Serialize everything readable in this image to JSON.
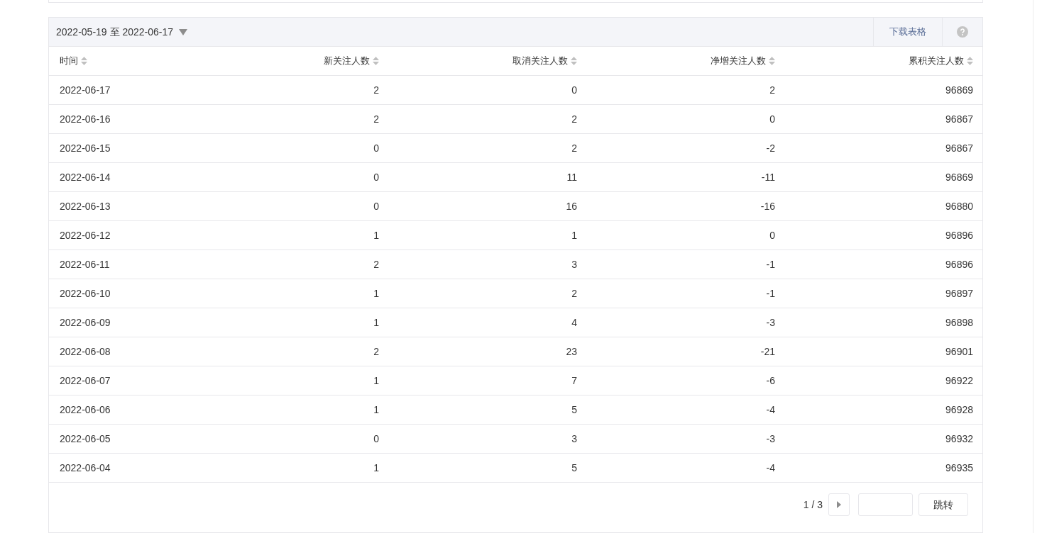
{
  "toolbar": {
    "date_range": "2022-05-19 至 2022-06-17",
    "download": "下载表格"
  },
  "table": {
    "columns": [
      "时间",
      "新关注人数",
      "取消关注人数",
      "净增关注人数",
      "累积关注人数"
    ],
    "rows": [
      [
        "2022-06-17",
        "2",
        "0",
        "2",
        "96869"
      ],
      [
        "2022-06-16",
        "2",
        "2",
        "0",
        "96867"
      ],
      [
        "2022-06-15",
        "0",
        "2",
        "-2",
        "96867"
      ],
      [
        "2022-06-14",
        "0",
        "11",
        "-11",
        "96869"
      ],
      [
        "2022-06-13",
        "0",
        "16",
        "-16",
        "96880"
      ],
      [
        "2022-06-12",
        "1",
        "1",
        "0",
        "96896"
      ],
      [
        "2022-06-11",
        "2",
        "3",
        "-1",
        "96896"
      ],
      [
        "2022-06-10",
        "1",
        "2",
        "-1",
        "96897"
      ],
      [
        "2022-06-09",
        "1",
        "4",
        "-3",
        "96898"
      ],
      [
        "2022-06-08",
        "2",
        "23",
        "-21",
        "96901"
      ],
      [
        "2022-06-07",
        "1",
        "7",
        "-6",
        "96922"
      ],
      [
        "2022-06-06",
        "1",
        "5",
        "-4",
        "96928"
      ],
      [
        "2022-06-05",
        "0",
        "3",
        "-3",
        "96932"
      ],
      [
        "2022-06-04",
        "1",
        "5",
        "-4",
        "96935"
      ]
    ]
  },
  "pagination": {
    "page": "1 / 3",
    "jump": "跳转"
  }
}
